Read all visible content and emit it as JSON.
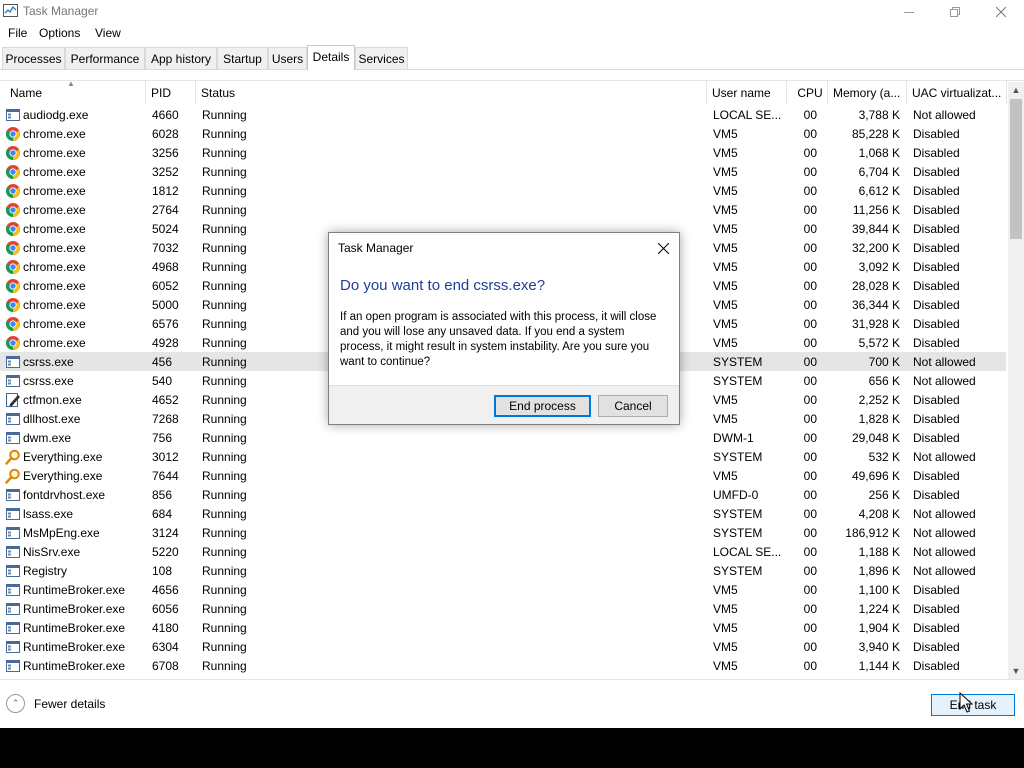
{
  "window": {
    "title": "Task Manager",
    "controls": {
      "minimize": "minimize-icon",
      "restore": "restore-icon",
      "close": "close-icon"
    }
  },
  "menu": [
    "File",
    "Options",
    "View"
  ],
  "tabs": [
    {
      "label": "Processes",
      "active": false
    },
    {
      "label": "Performance",
      "active": false
    },
    {
      "label": "App history",
      "active": false
    },
    {
      "label": "Startup",
      "active": false
    },
    {
      "label": "Users",
      "active": false
    },
    {
      "label": "Details",
      "active": true
    },
    {
      "label": "Services",
      "active": false
    }
  ],
  "columns": [
    "Name",
    "PID",
    "Status",
    "User name",
    "CPU",
    "Memory (a...",
    "UAC virtualizat..."
  ],
  "rows": [
    {
      "name": "audiodg.exe",
      "pid": "4660",
      "status": "Running",
      "user": "LOCAL SE...",
      "cpu": "00",
      "memory": "3,788 K",
      "uac": "Not allowed",
      "icon": "generic-exe-icon"
    },
    {
      "name": "chrome.exe",
      "pid": "6028",
      "status": "Running",
      "user": "VM5",
      "cpu": "00",
      "memory": "85,228 K",
      "uac": "Disabled",
      "icon": "chrome-icon"
    },
    {
      "name": "chrome.exe",
      "pid": "3256",
      "status": "Running",
      "user": "VM5",
      "cpu": "00",
      "memory": "1,068 K",
      "uac": "Disabled",
      "icon": "chrome-icon"
    },
    {
      "name": "chrome.exe",
      "pid": "3252",
      "status": "Running",
      "user": "VM5",
      "cpu": "00",
      "memory": "6,704 K",
      "uac": "Disabled",
      "icon": "chrome-icon"
    },
    {
      "name": "chrome.exe",
      "pid": "1812",
      "status": "Running",
      "user": "VM5",
      "cpu": "00",
      "memory": "6,612 K",
      "uac": "Disabled",
      "icon": "chrome-icon"
    },
    {
      "name": "chrome.exe",
      "pid": "2764",
      "status": "Running",
      "user": "VM5",
      "cpu": "00",
      "memory": "11,256 K",
      "uac": "Disabled",
      "icon": "chrome-icon"
    },
    {
      "name": "chrome.exe",
      "pid": "5024",
      "status": "Running",
      "user": "VM5",
      "cpu": "00",
      "memory": "39,844 K",
      "uac": "Disabled",
      "icon": "chrome-icon"
    },
    {
      "name": "chrome.exe",
      "pid": "7032",
      "status": "Running",
      "user": "VM5",
      "cpu": "00",
      "memory": "32,200 K",
      "uac": "Disabled",
      "icon": "chrome-icon"
    },
    {
      "name": "chrome.exe",
      "pid": "4968",
      "status": "Running",
      "user": "VM5",
      "cpu": "00",
      "memory": "3,092 K",
      "uac": "Disabled",
      "icon": "chrome-icon"
    },
    {
      "name": "chrome.exe",
      "pid": "6052",
      "status": "Running",
      "user": "VM5",
      "cpu": "00",
      "memory": "28,028 K",
      "uac": "Disabled",
      "icon": "chrome-icon"
    },
    {
      "name": "chrome.exe",
      "pid": "5000",
      "status": "Running",
      "user": "VM5",
      "cpu": "00",
      "memory": "36,344 K",
      "uac": "Disabled",
      "icon": "chrome-icon"
    },
    {
      "name": "chrome.exe",
      "pid": "6576",
      "status": "Running",
      "user": "VM5",
      "cpu": "00",
      "memory": "31,928 K",
      "uac": "Disabled",
      "icon": "chrome-icon"
    },
    {
      "name": "chrome.exe",
      "pid": "4928",
      "status": "Running",
      "user": "VM5",
      "cpu": "00",
      "memory": "5,572 K",
      "uac": "Disabled",
      "icon": "chrome-icon"
    },
    {
      "name": "csrss.exe",
      "pid": "456",
      "status": "Running",
      "user": "SYSTEM",
      "cpu": "00",
      "memory": "700 K",
      "uac": "Not allowed",
      "icon": "generic-exe-icon",
      "selected": true
    },
    {
      "name": "csrss.exe",
      "pid": "540",
      "status": "Running",
      "user": "SYSTEM",
      "cpu": "00",
      "memory": "656 K",
      "uac": "Not allowed",
      "icon": "generic-exe-icon"
    },
    {
      "name": "ctfmon.exe",
      "pid": "4652",
      "status": "Running",
      "user": "VM5",
      "cpu": "00",
      "memory": "2,252 K",
      "uac": "Disabled",
      "icon": "pen-icon"
    },
    {
      "name": "dllhost.exe",
      "pid": "7268",
      "status": "Running",
      "user": "VM5",
      "cpu": "00",
      "memory": "1,828 K",
      "uac": "Disabled",
      "icon": "generic-exe-icon"
    },
    {
      "name": "dwm.exe",
      "pid": "756",
      "status": "Running",
      "user": "DWM-1",
      "cpu": "00",
      "memory": "29,048 K",
      "uac": "Disabled",
      "icon": "generic-exe-icon"
    },
    {
      "name": "Everything.exe",
      "pid": "3012",
      "status": "Running",
      "user": "SYSTEM",
      "cpu": "00",
      "memory": "532 K",
      "uac": "Not allowed",
      "icon": "magnifier-icon"
    },
    {
      "name": "Everything.exe",
      "pid": "7644",
      "status": "Running",
      "user": "VM5",
      "cpu": "00",
      "memory": "49,696 K",
      "uac": "Disabled",
      "icon": "magnifier-icon"
    },
    {
      "name": "fontdrvhost.exe",
      "pid": "856",
      "status": "Running",
      "user": "UMFD-0",
      "cpu": "00",
      "memory": "256 K",
      "uac": "Disabled",
      "icon": "generic-exe-icon"
    },
    {
      "name": "lsass.exe",
      "pid": "684",
      "status": "Running",
      "user": "SYSTEM",
      "cpu": "00",
      "memory": "4,208 K",
      "uac": "Not allowed",
      "icon": "generic-exe-icon"
    },
    {
      "name": "MsMpEng.exe",
      "pid": "3124",
      "status": "Running",
      "user": "SYSTEM",
      "cpu": "00",
      "memory": "186,912 K",
      "uac": "Not allowed",
      "icon": "generic-exe-icon"
    },
    {
      "name": "NisSrv.exe",
      "pid": "5220",
      "status": "Running",
      "user": "LOCAL SE...",
      "cpu": "00",
      "memory": "1,188 K",
      "uac": "Not allowed",
      "icon": "generic-exe-icon"
    },
    {
      "name": "Registry",
      "pid": "108",
      "status": "Running",
      "user": "SYSTEM",
      "cpu": "00",
      "memory": "1,896 K",
      "uac": "Not allowed",
      "icon": "generic-exe-icon"
    },
    {
      "name": "RuntimeBroker.exe",
      "pid": "4656",
      "status": "Running",
      "user": "VM5",
      "cpu": "00",
      "memory": "1,100 K",
      "uac": "Disabled",
      "icon": "generic-exe-icon"
    },
    {
      "name": "RuntimeBroker.exe",
      "pid": "6056",
      "status": "Running",
      "user": "VM5",
      "cpu": "00",
      "memory": "1,224 K",
      "uac": "Disabled",
      "icon": "generic-exe-icon"
    },
    {
      "name": "RuntimeBroker.exe",
      "pid": "4180",
      "status": "Running",
      "user": "VM5",
      "cpu": "00",
      "memory": "1,904 K",
      "uac": "Disabled",
      "icon": "generic-exe-icon"
    },
    {
      "name": "RuntimeBroker.exe",
      "pid": "6304",
      "status": "Running",
      "user": "VM5",
      "cpu": "00",
      "memory": "3,940 K",
      "uac": "Disabled",
      "icon": "generic-exe-icon"
    },
    {
      "name": "RuntimeBroker.exe",
      "pid": "6708",
      "status": "Running",
      "user": "VM5",
      "cpu": "00",
      "memory": "1,144 K",
      "uac": "Disabled",
      "icon": "generic-exe-icon"
    }
  ],
  "footer": {
    "fewer_details": "Fewer details",
    "end_task": "End task"
  },
  "dialog": {
    "title": "Task Manager",
    "heading": "Do you want to end csrss.exe?",
    "body": "If an open program is associated with this process, it will close and you will lose any unsaved data. If you end a system process, it might result in system instability. Are you sure you want to continue?",
    "primary_button": "End process",
    "cancel_button": "Cancel"
  },
  "colors": {
    "selection": "#e5e5e5",
    "accent": "#0078d7",
    "dialog_heading": "#1f3f99"
  }
}
